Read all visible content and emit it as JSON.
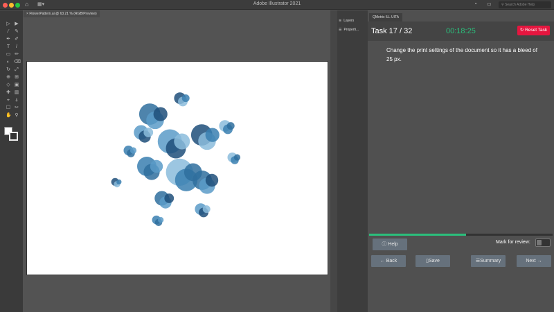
{
  "app": {
    "title": "Adobe Illustrator 2021",
    "search_placeholder": "Search Adobe Help"
  },
  "document": {
    "tab": "FlowerPattern.ai @ 63.21 % (RGB/Preview)"
  },
  "panels": {
    "items": [
      {
        "label": "Layers",
        "icon": "layers-icon"
      },
      {
        "label": "Properti...",
        "icon": "properties-icon"
      }
    ]
  },
  "task_panel": {
    "tab": "QMetrix ILL UITA",
    "task": "Task 17 / 32",
    "timer": "00:18:25",
    "reset_label": "Reset Task",
    "instruction": "Change the print settings of the document so it has a bleed of 25 px.",
    "progress_percent": 53,
    "help_label": "Help",
    "mark_label": "Mark for review:",
    "mark_for_review": false,
    "back_label": "Back",
    "save_label": "Save",
    "summary_label": "Summary",
    "next_label": "Next"
  },
  "colors": {
    "accent": "#2bbf7c",
    "reset": "#e5163f",
    "flower": "#2f6e9e"
  }
}
